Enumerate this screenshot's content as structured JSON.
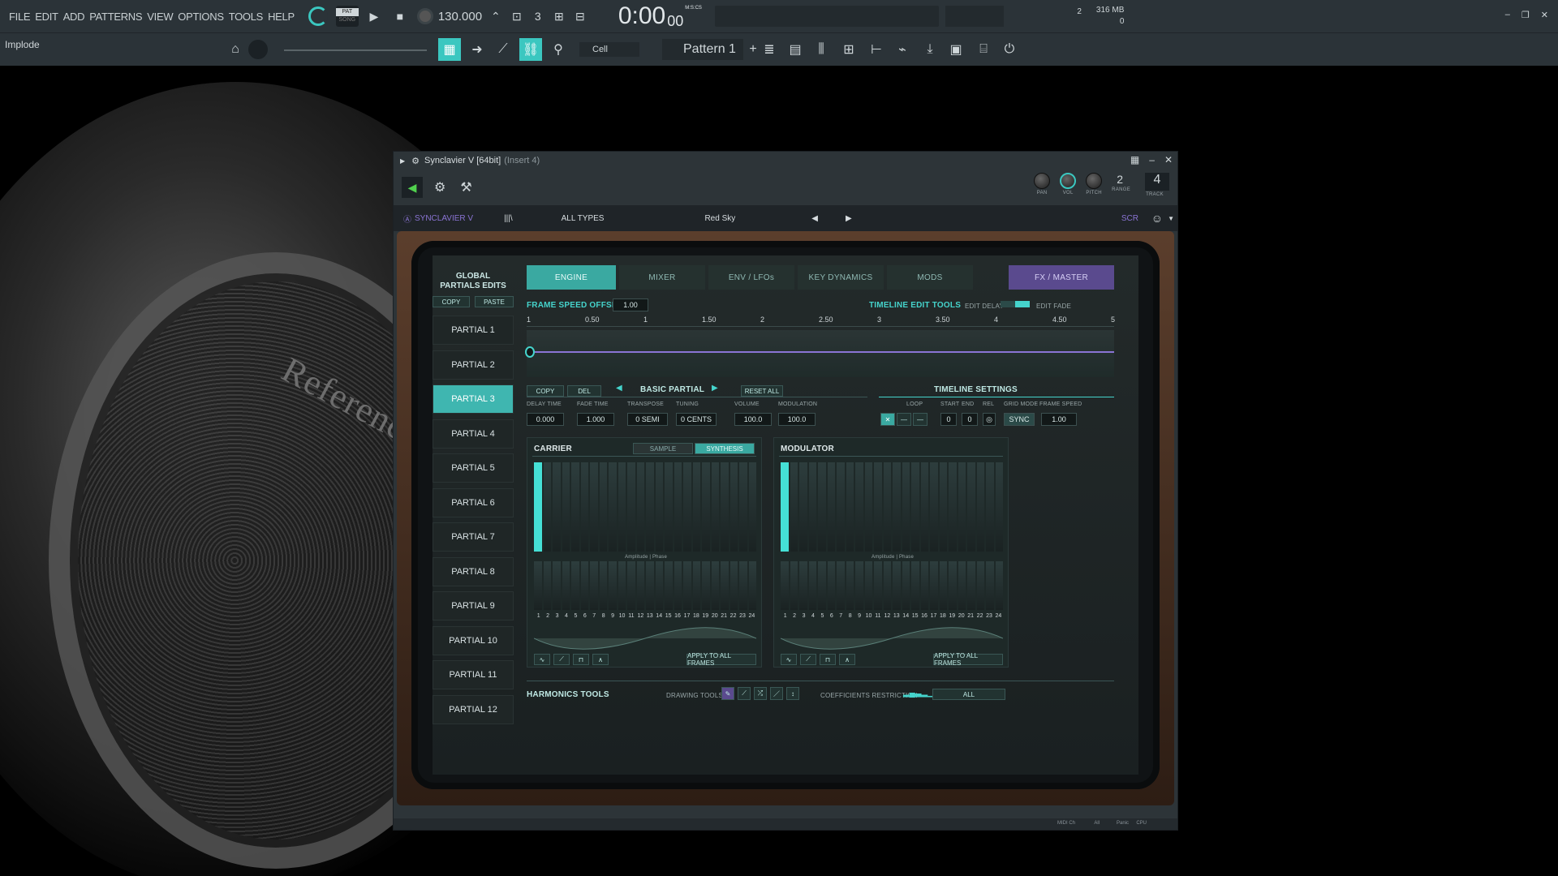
{
  "menu": [
    "FILE",
    "EDIT",
    "ADD",
    "PATTERNS",
    "VIEW",
    "OPTIONS",
    "TOOLS",
    "HELP"
  ],
  "transport": {
    "pat_label": "PAT",
    "song_label": "SONG",
    "tempo": "130.000",
    "time": "0:00",
    "time_sub": "00",
    "time_unit": "M:S:CS"
  },
  "stats": {
    "memory": "316 MB",
    "voices": "0",
    "cpu_num": "2"
  },
  "hint": "Implode",
  "snap": "Cell",
  "pattern": "Pattern 1",
  "window": {
    "title": "Synclavier V [64bit]",
    "insert": "(Insert 4)"
  },
  "knobs": {
    "pan": "PAN",
    "vol": "VOL",
    "pitch": "PITCH",
    "range": "RANGE",
    "range_val": "2",
    "track": "TRACK",
    "track_val": "4"
  },
  "presetbar": {
    "brand": "SYNCLAVIER V",
    "types": "ALL TYPES",
    "preset": "Red Sky",
    "scr": "SCR"
  },
  "global": {
    "title1": "GLOBAL",
    "title2": "PARTIALS EDITS",
    "copy": "COPY",
    "paste": "PASTE"
  },
  "partials": [
    "PARTIAL 1",
    "PARTIAL 2",
    "PARTIAL 3",
    "PARTIAL 4",
    "PARTIAL 5",
    "PARTIAL 6",
    "PARTIAL 7",
    "PARTIAL 8",
    "PARTIAL 9",
    "PARTIAL 10",
    "PARTIAL 11",
    "PARTIAL 12"
  ],
  "tabs": [
    "ENGINE",
    "MIXER",
    "ENV / LFOs",
    "KEY DYNAMICS",
    "MODS",
    "FX / MASTER"
  ],
  "frame": {
    "label": "FRAME SPEED OFFSET",
    "value": "1.00",
    "tools": "TIMELINE EDIT TOOLS",
    "edit_delay": "EDIT DELAY",
    "edit_fade": "EDIT FADE"
  },
  "ruler": [
    "1",
    "0.50",
    "1",
    "1.50",
    "2",
    "2.50",
    "3",
    "3.50",
    "4",
    "4.50",
    "5"
  ],
  "partial_edit": {
    "copy": "COPY",
    "del": "DEL",
    "name": "BASIC PARTIAL",
    "reset": "RESET ALL",
    "timeline_settings": "TIMELINE SETTINGS"
  },
  "params": {
    "labels": [
      "DELAY TIME",
      "FADE TIME",
      "TRANSPOSE",
      "TUNING",
      "VOLUME",
      "MODULATION"
    ],
    "values": [
      "0.000",
      "1.000",
      "0 SEMI",
      "0 CENTS",
      "100.0",
      "100.0"
    ]
  },
  "timeline": {
    "labels": [
      "LOOP",
      "START",
      "END",
      "REL",
      "GRID MODE",
      "FRAME SPEED"
    ],
    "start": "0",
    "end": "0",
    "grid": "SYNC",
    "speed": "1.00"
  },
  "carrier": {
    "title": "CARRIER",
    "sample": "SAMPLE",
    "synthesis": "SYNTHESIS",
    "amp": "Amplitude | Phase",
    "apply": "APPLY TO ALL FRAMES"
  },
  "modulator": {
    "title": "MODULATOR",
    "amp": "Amplitude | Phase",
    "apply": "APPLY TO ALL FRAMES"
  },
  "harmonics": [
    "1",
    "2",
    "3",
    "4",
    "5",
    "6",
    "7",
    "8",
    "9",
    "10",
    "11",
    "12",
    "13",
    "14",
    "15",
    "16",
    "17",
    "18",
    "19",
    "20",
    "21",
    "22",
    "23",
    "24"
  ],
  "bottom": {
    "title": "HARMONICS TOOLS",
    "drawing": "DRAWING TOOLS",
    "coef": "COEFFICIENTS RESTRICTION",
    "all": "ALL"
  },
  "statusbar": {
    "midi": "MIDI Ch",
    "all": "All",
    "panic": "Panic",
    "cpu": "CPU"
  },
  "colors": {
    "accent": "#45d4cc",
    "fx": "#5a4a8e"
  }
}
